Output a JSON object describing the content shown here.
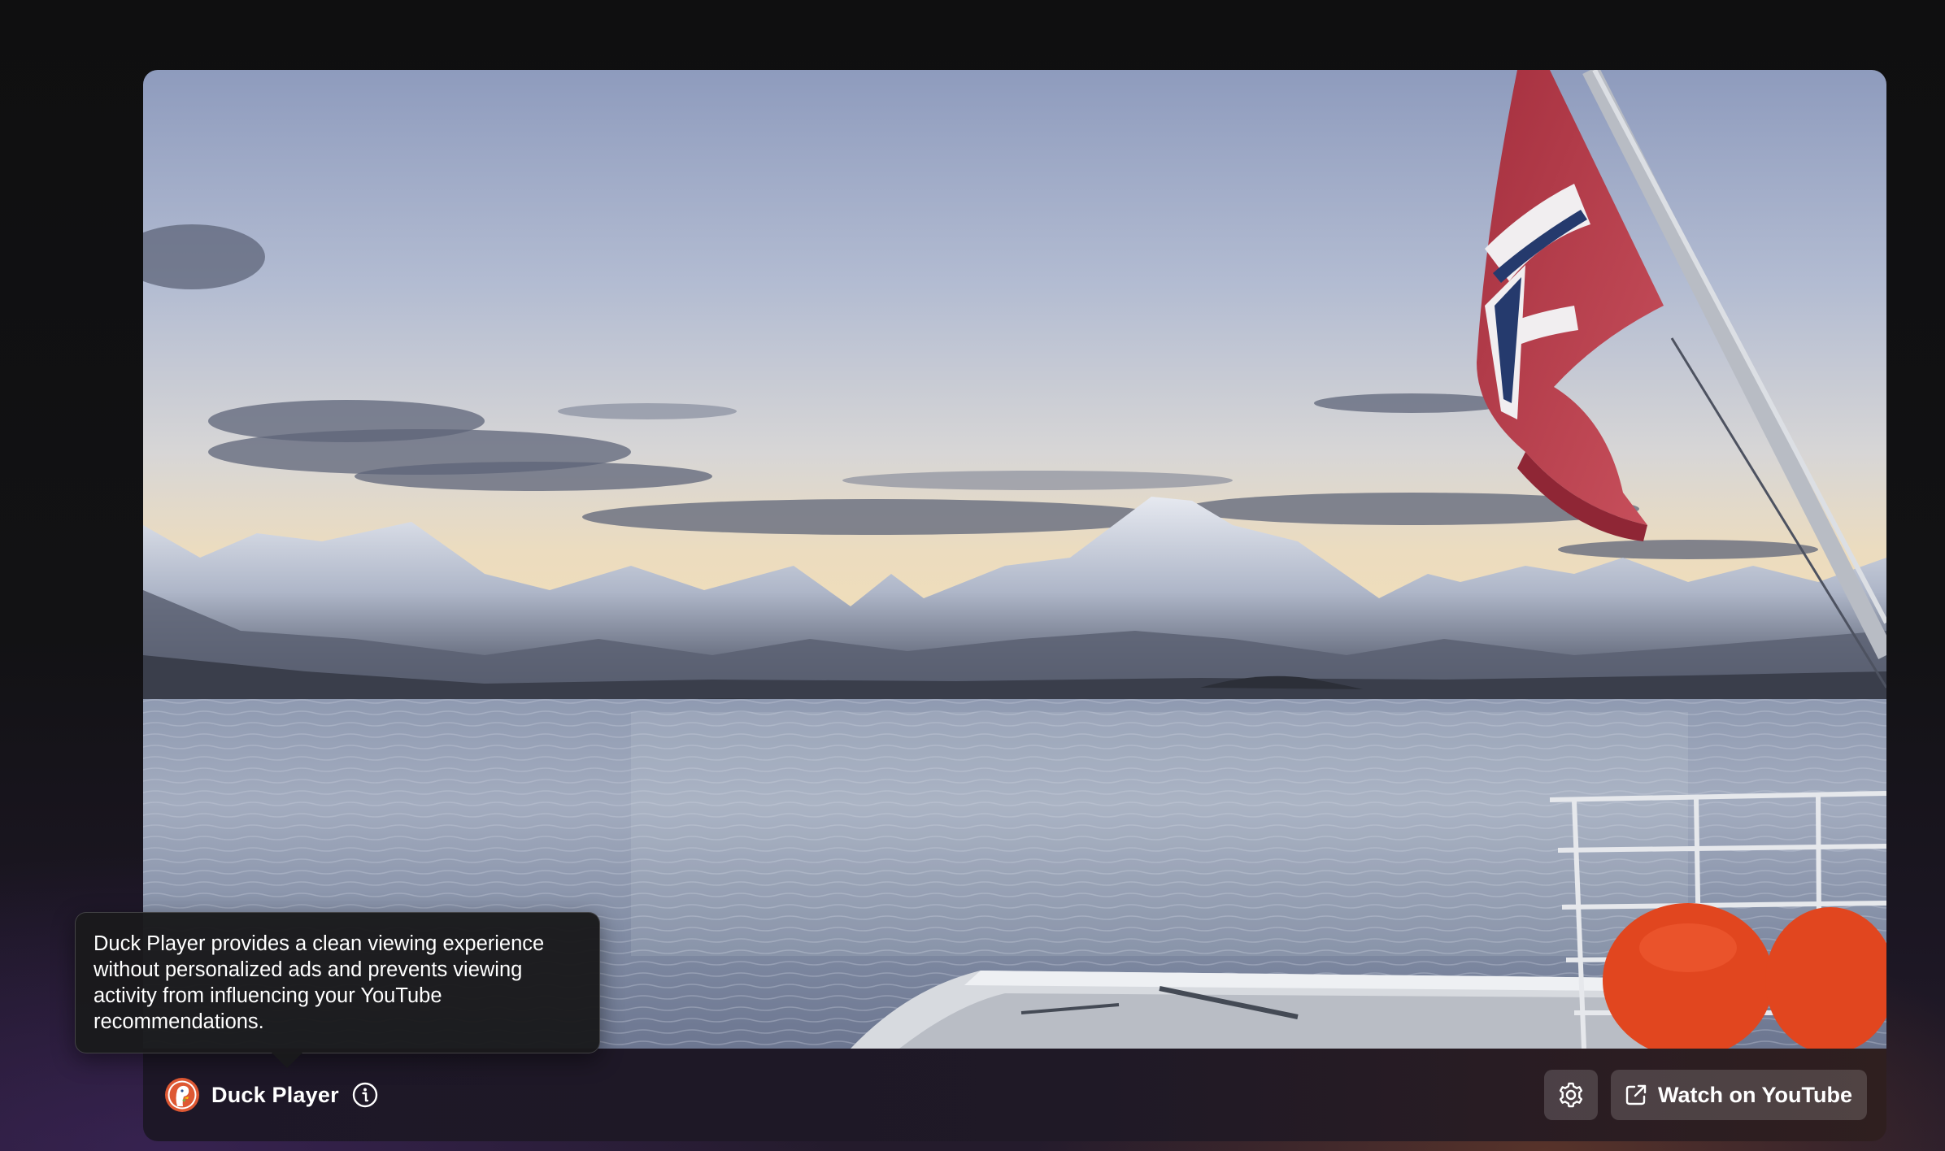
{
  "player": {
    "brand_name": "Duck Player",
    "logo_icon": "duckduckgo-logo-icon",
    "info_icon": "info-icon",
    "settings_icon": "gear-icon",
    "watch_button_label": "Watch on YouTube",
    "watch_button_icon": "open-external-icon"
  },
  "tooltip": {
    "text": "Duck Player provides a clean viewing experience without personalized ads and prevents viewing activity from influencing your YouTube recommendations."
  },
  "video": {
    "scene": "fjord-mountains-norwegian-flag"
  },
  "colors": {
    "page_background": "#111111",
    "button_background": "#3a3440",
    "logo_orange": "#DE5833",
    "flag_red": "#B23A48"
  }
}
